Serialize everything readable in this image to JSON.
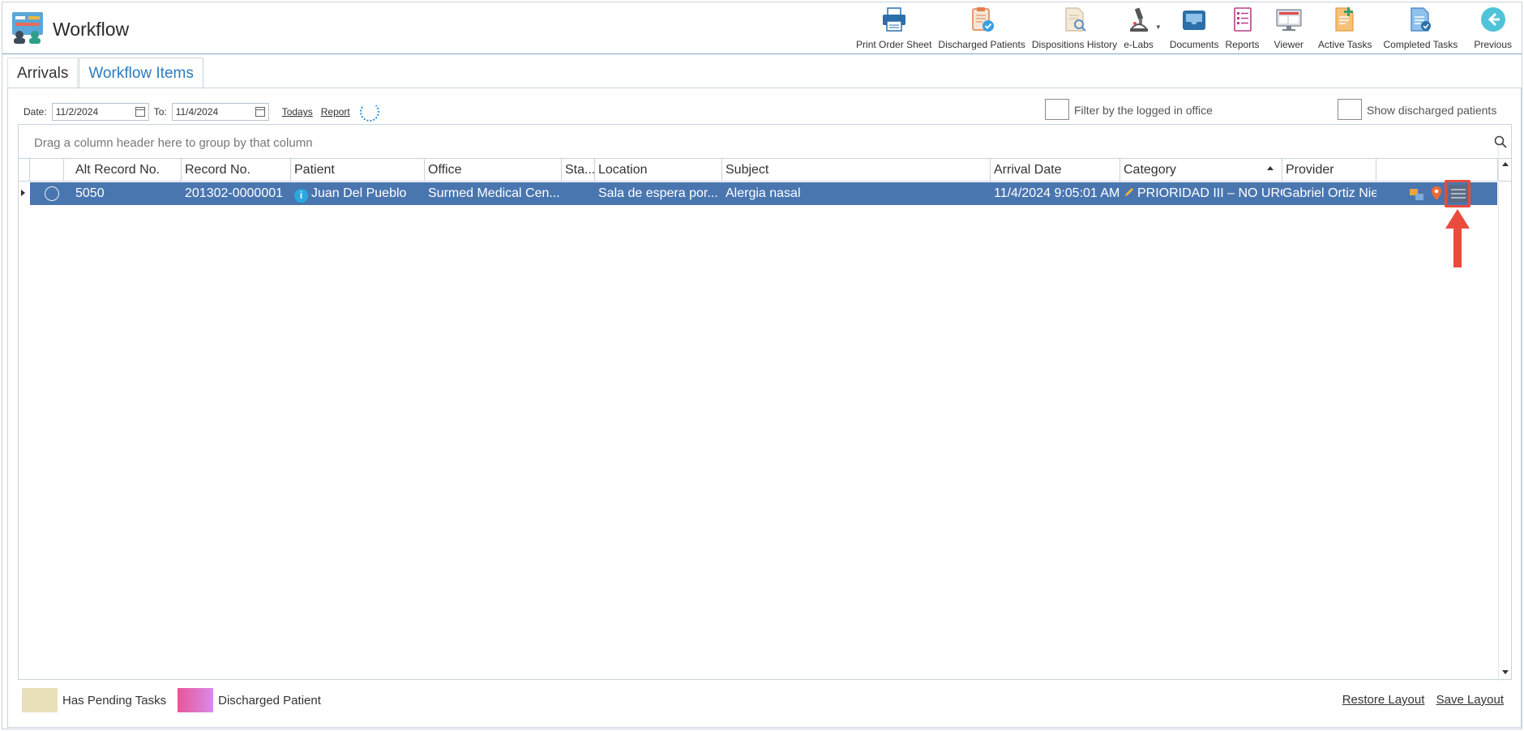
{
  "app": {
    "title": "Workflow"
  },
  "toolbar": [
    {
      "label": "Print Order Sheet",
      "icon": "printer-icon"
    },
    {
      "label": "Discharged Patients",
      "icon": "clipboard-check-icon"
    },
    {
      "label": "Dispositions History",
      "icon": "document-search-icon"
    },
    {
      "label": "e-Labs",
      "icon": "microscope-icon"
    },
    {
      "label": "Documents",
      "icon": "inbox-tray-icon"
    },
    {
      "label": "Reports",
      "icon": "report-list-icon"
    },
    {
      "label": "Viewer",
      "icon": "monitor-icon"
    },
    {
      "label": "Active Tasks",
      "icon": "active-tasks-icon"
    },
    {
      "label": "Completed Tasks",
      "icon": "completed-tasks-icon"
    },
    {
      "label": "Previous",
      "icon": "back-arrow-icon"
    }
  ],
  "tabs": [
    {
      "label": "Arrivals",
      "active": false
    },
    {
      "label": "Workflow Items",
      "active": true
    }
  ],
  "filters": {
    "date_label": "Date:",
    "date_from": "11/2/2024",
    "to_label": "To:",
    "date_to": "11/4/2024",
    "todays_link": "Todays",
    "report_link": "Report",
    "filter_office_label": "Filter by the logged in office",
    "show_discharged_label": "Show discharged patients"
  },
  "grid": {
    "group_hint": "Drag a column header here to group by that column",
    "columns": [
      "Alt Record No.",
      "Record No.",
      "Patient",
      "Office",
      "Sta...",
      "Location",
      "Subject",
      "Arrival Date",
      "Category",
      "Provider"
    ],
    "rows": [
      {
        "alt_record": "5050",
        "record": "201302-0000001",
        "patient": "Juan Del Pueblo",
        "office": "Surmed Medical Cen...",
        "status": "",
        "location": "Sala de espera por...",
        "subject": "Alergia nasal",
        "arrival_date": "11/4/2024 9:05:01 AM",
        "category": "PRIORIDAD III – NO URGENTE",
        "provider": "Gabriel Ortiz Nieves"
      }
    ]
  },
  "legend": {
    "pending_label": "Has Pending Tasks",
    "pending_color": "#e8e0b8",
    "discharged_label": "Discharged Patient",
    "discharged_color": "#e8559a"
  },
  "footer": {
    "restore_layout": "Restore Layout",
    "save_layout": "Save Layout"
  },
  "colors": {
    "selected_row": "#4a76b0",
    "accent": "#2c7bc1",
    "callout": "#e94b3c"
  }
}
